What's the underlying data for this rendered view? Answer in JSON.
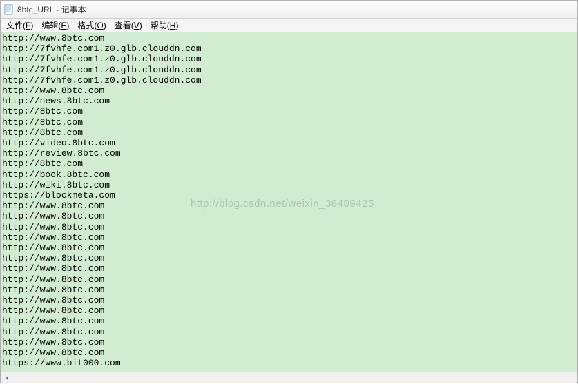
{
  "titlebar": {
    "title": "8btc_URL - 记事本"
  },
  "menubar": {
    "file": "文件",
    "file_key": "F",
    "edit": "编辑",
    "edit_key": "E",
    "format": "格式",
    "format_key": "O",
    "view": "查看",
    "view_key": "V",
    "help": "帮助",
    "help_key": "H"
  },
  "watermark": "http://blog.csdn.net/weixin_38409425",
  "content": {
    "lines": [
      "http://www.8btc.com",
      "http://7fvhfe.com1.z0.glb.clouddn.com",
      "http://7fvhfe.com1.z0.glb.clouddn.com",
      "http://7fvhfe.com1.z0.glb.clouddn.com",
      "http://7fvhfe.com1.z0.glb.clouddn.com",
      "http://www.8btc.com",
      "http://news.8btc.com",
      "http://8btc.com",
      "http://8btc.com",
      "http://8btc.com",
      "http://video.8btc.com",
      "http://review.8btc.com",
      "http://8btc.com",
      "http://book.8btc.com",
      "http://wiki.8btc.com",
      "https://blockmeta.com",
      "http://www.8btc.com",
      "http://www.8btc.com",
      "http://www.8btc.com",
      "http://www.8btc.com",
      "http://www.8btc.com",
      "http://www.8btc.com",
      "http://www.8btc.com",
      "http://www.8btc.com",
      "http://www.8btc.com",
      "http://www.8btc.com",
      "http://www.8btc.com",
      "http://www.8btc.com",
      "http://www.8btc.com",
      "http://www.8btc.com",
      "http://www.8btc.com",
      "https://www.bit000.com"
    ]
  }
}
